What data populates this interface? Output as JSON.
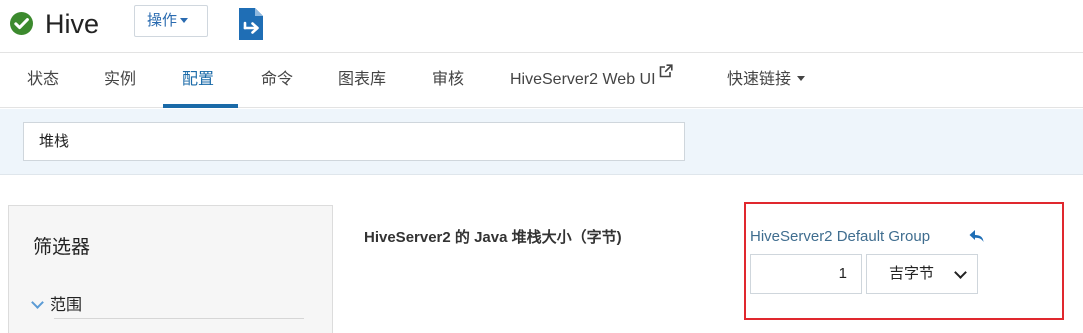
{
  "header": {
    "service_name": "Hive",
    "status_icon": "check-circle-icon",
    "status_color": "#3c8a2e",
    "actions_label": "操作",
    "export_icon": "export-file-icon",
    "accent_color": "#1a6aa8"
  },
  "tabs": [
    {
      "label": "状态"
    },
    {
      "label": "实例"
    },
    {
      "label": "配置",
      "active": true
    },
    {
      "label": "命令"
    },
    {
      "label": "图表库"
    },
    {
      "label": "审核"
    },
    {
      "label": "HiveServer2 Web UI",
      "icon": "external-link-icon"
    },
    {
      "label": "快速链接",
      "icon": "caret-down-icon"
    }
  ],
  "search": {
    "value": "堆栈"
  },
  "filter": {
    "title": "筛选器",
    "scope_label": "范围"
  },
  "property": {
    "label": "HiveServer2 的 Java 堆栈大小（字节)",
    "group_name": "HiveServer2 Default Group",
    "undo_icon": "undo-icon",
    "value": "1",
    "unit": "吉字节",
    "highlight_color": "#e0282e"
  }
}
